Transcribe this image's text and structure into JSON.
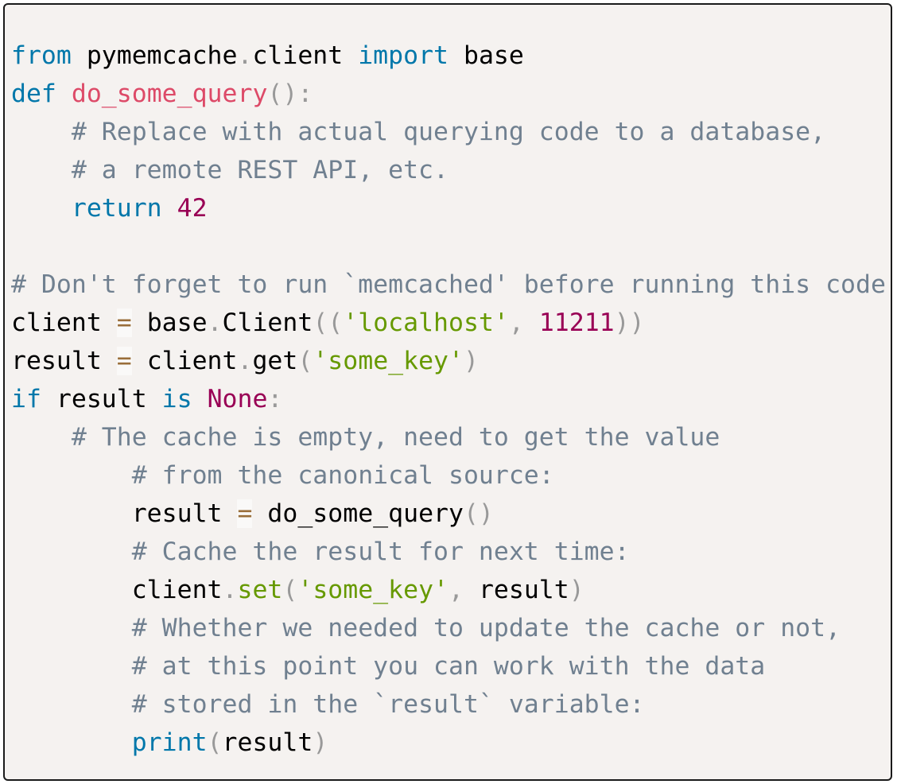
{
  "language": "python",
  "colors": {
    "background": "#f5f2f0",
    "keyword": "#0077aa",
    "function": "#dd4a68",
    "comment": "#708090",
    "number": "#990055",
    "string": "#669900",
    "operator": "#9a6e3a",
    "punctuation": "#999999"
  },
  "lines": [
    {
      "tokens": [
        {
          "t": "kw",
          "v": "from"
        },
        {
          "t": "tx",
          "v": " pymemcache"
        },
        {
          "t": "pn",
          "v": "."
        },
        {
          "t": "tx",
          "v": "client "
        },
        {
          "t": "kw",
          "v": "import"
        },
        {
          "t": "tx",
          "v": " base"
        }
      ]
    },
    {
      "tokens": [
        {
          "t": "kw",
          "v": "def"
        },
        {
          "t": "tx",
          "v": " "
        },
        {
          "t": "fn",
          "v": "do_some_query"
        },
        {
          "t": "pn",
          "v": "():"
        }
      ]
    },
    {
      "tokens": [
        {
          "t": "tx",
          "v": "    "
        },
        {
          "t": "cm",
          "v": "# Replace with actual querying code to a database,"
        }
      ]
    },
    {
      "tokens": [
        {
          "t": "tx",
          "v": "    "
        },
        {
          "t": "cm",
          "v": "# a remote REST API, etc."
        }
      ]
    },
    {
      "tokens": [
        {
          "t": "tx",
          "v": "    "
        },
        {
          "t": "kw",
          "v": "return"
        },
        {
          "t": "tx",
          "v": " "
        },
        {
          "t": "num",
          "v": "42"
        }
      ]
    },
    {
      "tokens": []
    },
    {
      "tokens": [
        {
          "t": "cm",
          "v": "# Don't forget to run `memcached' before running this code"
        }
      ]
    },
    {
      "tokens": [
        {
          "t": "tx",
          "v": "client "
        },
        {
          "t": "op",
          "v": "="
        },
        {
          "t": "tx",
          "v": " base"
        },
        {
          "t": "pn",
          "v": "."
        },
        {
          "t": "tx",
          "v": "Client"
        },
        {
          "t": "pn",
          "v": "(("
        },
        {
          "t": "str",
          "v": "'localhost'"
        },
        {
          "t": "pn",
          "v": ","
        },
        {
          "t": "tx",
          "v": " "
        },
        {
          "t": "num",
          "v": "11211"
        },
        {
          "t": "pn",
          "v": "))"
        }
      ]
    },
    {
      "tokens": [
        {
          "t": "tx",
          "v": "result "
        },
        {
          "t": "op",
          "v": "="
        },
        {
          "t": "tx",
          "v": " client"
        },
        {
          "t": "pn",
          "v": "."
        },
        {
          "t": "tx",
          "v": "get"
        },
        {
          "t": "pn",
          "v": "("
        },
        {
          "t": "str",
          "v": "'some_key'"
        },
        {
          "t": "pn",
          "v": ")"
        }
      ]
    },
    {
      "tokens": [
        {
          "t": "kw",
          "v": "if"
        },
        {
          "t": "tx",
          "v": " result "
        },
        {
          "t": "kw",
          "v": "is"
        },
        {
          "t": "tx",
          "v": " "
        },
        {
          "t": "num",
          "v": "None"
        },
        {
          "t": "pn",
          "v": ":"
        }
      ]
    },
    {
      "tokens": [
        {
          "t": "tx",
          "v": "    "
        },
        {
          "t": "cm",
          "v": "# The cache is empty, need to get the value"
        }
      ]
    },
    {
      "tokens": [
        {
          "t": "tx",
          "v": "        "
        },
        {
          "t": "cm",
          "v": "# from the canonical source:"
        }
      ]
    },
    {
      "tokens": [
        {
          "t": "tx",
          "v": "        result "
        },
        {
          "t": "op",
          "v": "="
        },
        {
          "t": "tx",
          "v": " do_some_query"
        },
        {
          "t": "pn",
          "v": "()"
        }
      ]
    },
    {
      "tokens": [
        {
          "t": "tx",
          "v": "        "
        },
        {
          "t": "cm",
          "v": "# Cache the result for next time:"
        }
      ]
    },
    {
      "tokens": [
        {
          "t": "tx",
          "v": "        client"
        },
        {
          "t": "pn",
          "v": "."
        },
        {
          "t": "str",
          "v": "set"
        },
        {
          "t": "pn",
          "v": "("
        },
        {
          "t": "str",
          "v": "'some_key'"
        },
        {
          "t": "pn",
          "v": ","
        },
        {
          "t": "tx",
          "v": " result"
        },
        {
          "t": "pn",
          "v": ")"
        }
      ]
    },
    {
      "tokens": [
        {
          "t": "tx",
          "v": "        "
        },
        {
          "t": "cm",
          "v": "# Whether we needed to update the cache or not,"
        }
      ]
    },
    {
      "tokens": [
        {
          "t": "tx",
          "v": "        "
        },
        {
          "t": "cm",
          "v": "# at this point you can work with the data"
        }
      ]
    },
    {
      "tokens": [
        {
          "t": "tx",
          "v": "        "
        },
        {
          "t": "cm",
          "v": "# stored in the `result` variable:"
        }
      ]
    },
    {
      "tokens": [
        {
          "t": "tx",
          "v": "        "
        },
        {
          "t": "kw",
          "v": "print"
        },
        {
          "t": "pn",
          "v": "("
        },
        {
          "t": "tx",
          "v": "result"
        },
        {
          "t": "pn",
          "v": ")"
        }
      ]
    }
  ]
}
